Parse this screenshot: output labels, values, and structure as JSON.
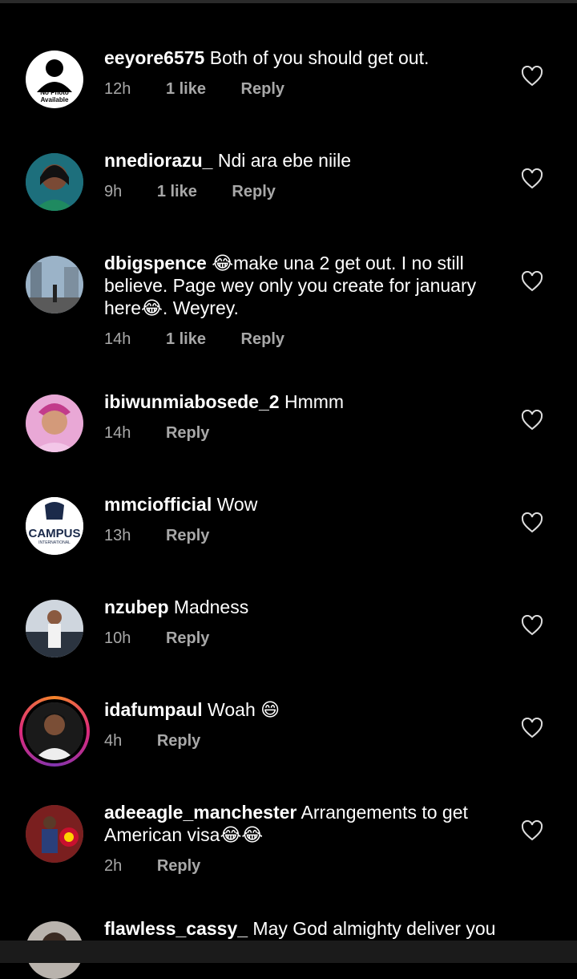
{
  "comments": [
    {
      "username": "eeyore6575",
      "text": " Both of you should get out.",
      "time": "12h",
      "likes": "1 like",
      "reply": "Reply",
      "avatar_label_1": "No Photo",
      "avatar_label_2": "Available"
    },
    {
      "username": "nnediorazu_",
      "text": " Ndi ara ebe niile",
      "time": "9h",
      "likes": "1 like",
      "reply": "Reply"
    },
    {
      "username": "dbigspence",
      "text_line1": "make una 2 get out. I no still",
      "text_line2": "believe. Page wey only you create for january",
      "text_line3a": "here",
      "text_line3b": ". Weyrey.",
      "time": "14h",
      "likes": "1 like",
      "reply": "Reply"
    },
    {
      "username": "ibiwunmiabosede_2",
      "text": " Hmmm",
      "time": "14h",
      "reply": "Reply"
    },
    {
      "username": "mmciofficial",
      "text": " Wow",
      "time": "13h",
      "reply": "Reply",
      "avatar_label": "CAMPUS",
      "avatar_sub": "INTERNATIONAL"
    },
    {
      "username": "nzubep",
      "text": " Madness",
      "time": "10h",
      "reply": "Reply"
    },
    {
      "username": "idafumpaul",
      "text": " Woah ",
      "time": "4h",
      "reply": "Reply"
    },
    {
      "username": "adeeagle_manchester",
      "text_line1": " Arrangements to get",
      "text_line2": "American visa",
      "time": "2h",
      "reply": "Reply"
    },
    {
      "username": "flawless_cassy_",
      "text": " May God almighty deliver you"
    }
  ],
  "colors": {
    "background": "#000000",
    "meta": "#a8a8a8",
    "ring_start": "#f58529",
    "ring_end": "#8134af"
  },
  "icons": {
    "like": "heart-outline-icon",
    "laugh": "face-with-tears-of-joy-emoji",
    "grin": "grinning-face-emoji"
  }
}
